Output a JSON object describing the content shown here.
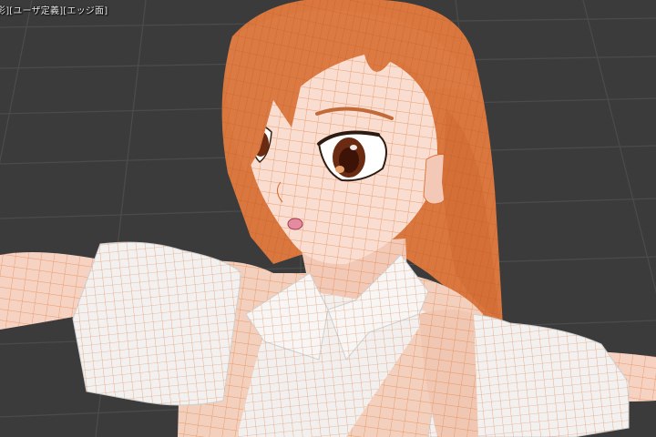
{
  "viewport": {
    "header_text": "影][ユーザ定義][エッジ面]",
    "background_color": "#3b3b3b",
    "grid_color": "#4a4a4a"
  },
  "model": {
    "wireframe_color": "#e0702a",
    "hair_color": "#d9773f",
    "skin_color": "#f6d2c2",
    "shirt_color": "#f2f0ee",
    "vest_color": "#f3d0bd",
    "eye_color": "#6b2a12"
  }
}
